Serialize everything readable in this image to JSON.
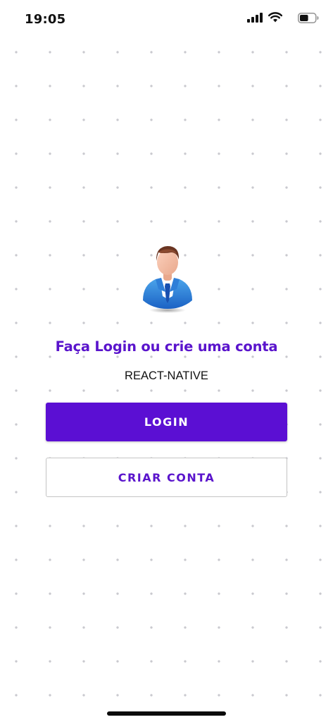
{
  "status_bar": {
    "time": "19:05",
    "signal_icon": "cellular-signal-icon",
    "wifi_icon": "wifi-icon",
    "battery_icon": "battery-icon",
    "battery_level": 0.55
  },
  "avatar": {
    "icon": "user-avatar-icon"
  },
  "title": "Faça Login ou crie uma conta",
  "subtitle": "REACT-NATIVE",
  "buttons": {
    "login_label": "LOGIN",
    "create_account_label": "CRIAR CONTA"
  },
  "colors": {
    "primary": "#5b0fd3",
    "title": "#5a14cc",
    "background": "#ffffff",
    "dot_grid": "#c9c9cf"
  }
}
